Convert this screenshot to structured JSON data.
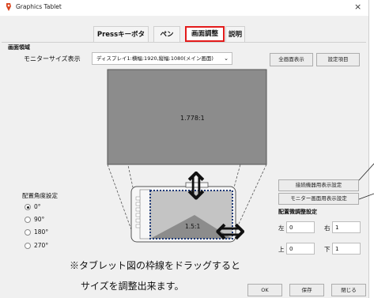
{
  "window": {
    "title": "Graphics Tablet",
    "close_glyph": "×",
    "icon": "app-pen-icon"
  },
  "tabs": [
    {
      "label": "Pressキーボタン",
      "active": false
    },
    {
      "label": "ペン",
      "active": false
    },
    {
      "label": "画面調整",
      "active": true
    },
    {
      "label": "説明",
      "active": false
    }
  ],
  "screen_area": {
    "section_label": "画面領域",
    "monitor_label": "モニターサイズ表示",
    "monitor_value": "ディスプレイ1:横幅:1920,縦幅:1080(メイン画面)",
    "dropdown_glyph": "⌄",
    "fullscreen_button": "全画面表示",
    "settings_button": "設定項目"
  },
  "preview": {
    "monitor_ratio": "1.778:1",
    "tablet_ratio": "1.5:1",
    "vertical_arrow": "⇕",
    "horizontal_arrow": "⇔"
  },
  "side_buttons": {
    "device_display": "接続機器用表示設定",
    "monitor_display": "モニター画面用表示設定"
  },
  "rotation": {
    "label": "配置角度設定",
    "options": [
      {
        "label": "0°",
        "selected": true
      },
      {
        "label": "90°",
        "selected": false
      },
      {
        "label": "180°",
        "selected": false
      },
      {
        "label": "270°",
        "selected": false
      }
    ]
  },
  "fine_adjust": {
    "label": "配置微調整設定",
    "left_label": "左",
    "left_value": "0",
    "right_label": "右",
    "right_value": "1",
    "top_label": "上",
    "top_value": "0",
    "bottom_label": "下",
    "bottom_value": "1"
  },
  "caption": {
    "line1": "※タブレット図の枠線をドラッグすると",
    "line2": "サイズを調整出来ます。"
  },
  "footer": {
    "ok": "OK",
    "save": "保存",
    "close": "閉じる"
  },
  "colors": {
    "accent_red": "#e31b1b",
    "preview_gray": "#8c8c8c",
    "dotted_blue": "#1f3a78"
  }
}
